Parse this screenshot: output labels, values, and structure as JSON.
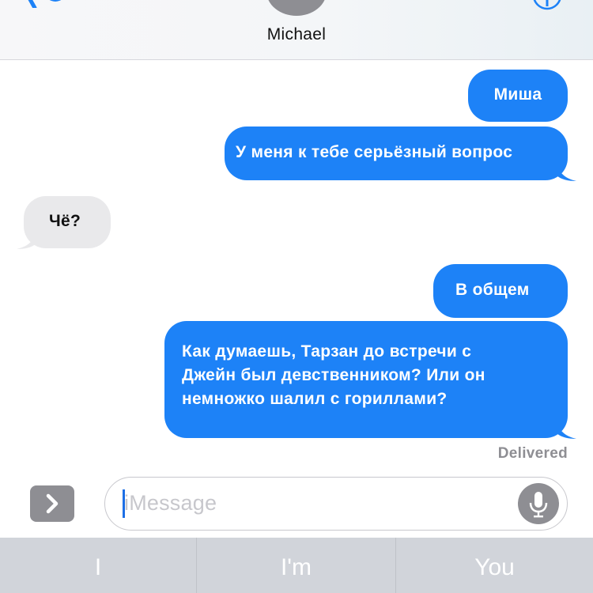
{
  "header": {
    "contact_name": "Michael",
    "icons": {
      "back": "back-chevron-icon",
      "avatar": "avatar",
      "info": "info-icon"
    }
  },
  "colors": {
    "outgoing_bubble": "#1d82f7",
    "incoming_bubble": "#e9e9eb",
    "delivered_text": "#8e8e93",
    "predictive_bar": "#d1d4da"
  },
  "messages": [
    {
      "direction": "outgoing",
      "text": "Миша"
    },
    {
      "direction": "outgoing",
      "text": "У меня к тебе серьёзный вопрос"
    },
    {
      "direction": "incoming",
      "text": "Чё?"
    },
    {
      "direction": "outgoing",
      "text": "В общем"
    },
    {
      "direction": "outgoing",
      "lines": [
        "Как думаешь, Тарзан до встречи с",
        "Джейн был девственником? Или он",
        "немножко шалил с гориллами?"
      ]
    }
  ],
  "status": "Delivered",
  "composer": {
    "placeholder": "iMessage",
    "icons": {
      "apps": "chevron-right-icon",
      "mic": "microphone-icon"
    }
  },
  "predictive": [
    "I",
    "I'm",
    "You"
  ]
}
